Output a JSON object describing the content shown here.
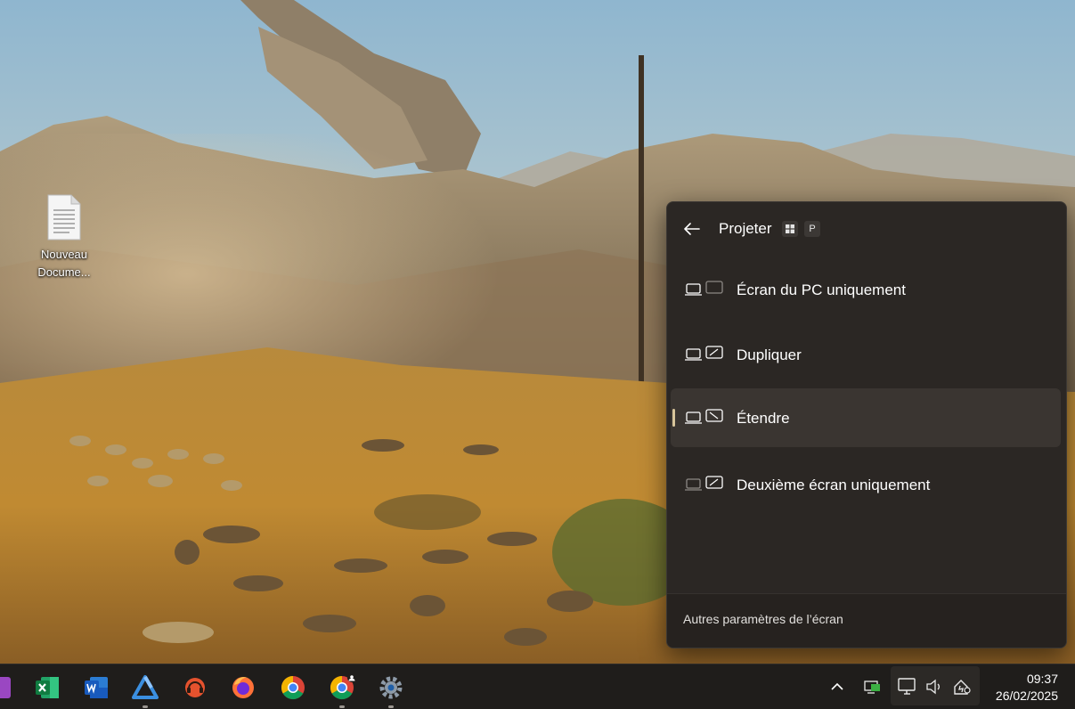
{
  "desktop": {
    "icon_label_line1": "Nouveau",
    "icon_label_line2": "Docume..."
  },
  "flyout": {
    "title": "Projeter",
    "shortcut_key": "P",
    "options": [
      {
        "label": "Écran du PC uniquement",
        "selected": false
      },
      {
        "label": "Dupliquer",
        "selected": false
      },
      {
        "label": "Étendre",
        "selected": true
      },
      {
        "label": "Deuxième écran uniquement",
        "selected": false
      }
    ],
    "footer_link": "Autres paramètres de l’écran",
    "accent_color": "#d8c59b"
  },
  "taskbar": {
    "apps": [
      "onenote-icon",
      "excel-icon",
      "word-icon",
      "drive-icon",
      "support-icon",
      "firefox-icon",
      "chrome-icon",
      "chrome-profile-icon",
      "settings-icon"
    ],
    "clock_time": "09:37",
    "clock_date": "26/02/2025"
  }
}
